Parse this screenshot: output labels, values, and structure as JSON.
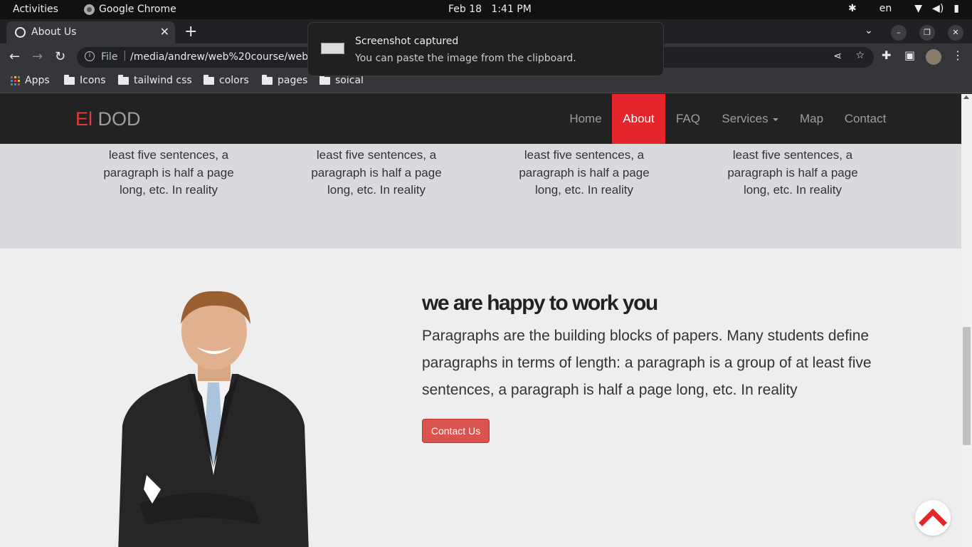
{
  "system_bar": {
    "activities": "Activities",
    "app_name": "Google Chrome",
    "date": "Feb 18",
    "time": "1:41 PM",
    "keyboard_layout": "en"
  },
  "browser": {
    "tab_title": "About Us",
    "url_scheme": "File",
    "url": "/media/andrew/web%20course/web/Pr",
    "bookmarks": [
      "Apps",
      "Icons",
      "tailwind css",
      "colors",
      "pages",
      "soical"
    ]
  },
  "notification": {
    "title": "Screenshot captured",
    "body": "You can paste the image from the clipboard."
  },
  "page": {
    "brand_accent": "El",
    "brand_rest": "DOD",
    "nav": [
      "Home",
      "About",
      "FAQ",
      "Services",
      "Map",
      "Contact"
    ],
    "active_nav": "About",
    "features": [
      "least five sentences, a paragraph is half a page long, etc. In reality",
      "least five sentences, a paragraph is half a page long, etc. In reality",
      "least five sentences, a paragraph is half a page long, etc. In reality",
      "least five sentences, a paragraph is half a page long, etc. In reality"
    ],
    "about_heading": "we are happy to work you",
    "about_paragraph": "Paragraphs are the building blocks of papers. Many students define paragraphs in terms of length: a paragraph is a group of at least five sentences, a paragraph is half a page long, etc. In reality",
    "cta_label": "Contact Us"
  },
  "colors": {
    "accent_red": "#e4262c",
    "navbar_bg": "#222222",
    "button_red": "#d9534f"
  }
}
